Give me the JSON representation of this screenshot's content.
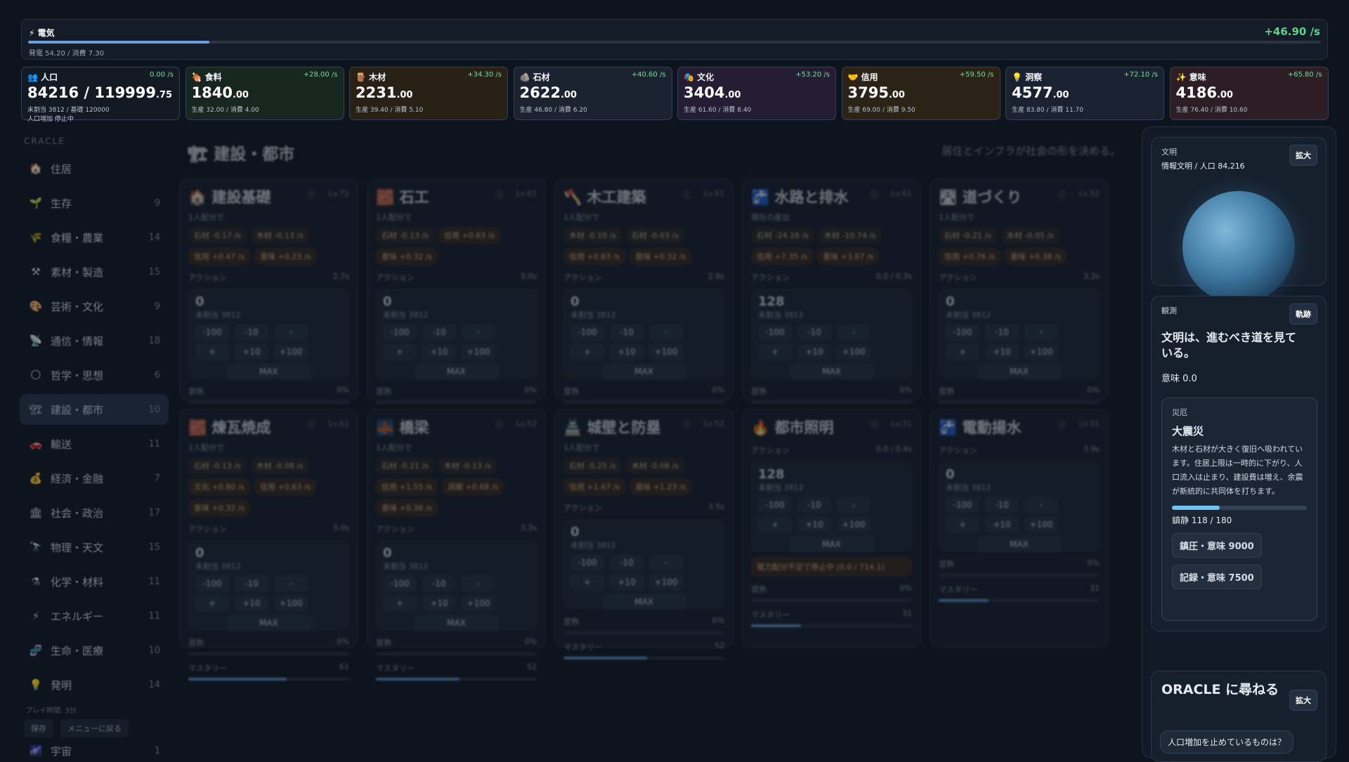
{
  "electricity": {
    "label": "⚡ 電気",
    "rate": "+46.90 /s",
    "sub": "発電 54.20 / 消費 7.30",
    "fill": 0.14
  },
  "resources": [
    {
      "icon": "👥",
      "name": "人口",
      "rate": "0.00 /s",
      "value": "84216 / 119999",
      "decimal": ".75",
      "sub": "未割当 3812 / 基礎 120000",
      "extra": "人口増加 停止中",
      "bg": "#141a24"
    },
    {
      "icon": "🍖",
      "name": "食料",
      "rate": "+28.00 /s",
      "value": "1840",
      "decimal": ".00",
      "sub": "生産 32.00 / 消費 4.00",
      "extra": "",
      "bg": "#17261e"
    },
    {
      "icon": "🪵",
      "name": "木材",
      "rate": "+34.30 /s",
      "value": "2231",
      "decimal": ".00",
      "sub": "生産 39.40 / 消費 5.10",
      "extra": "",
      "bg": "#2a2116"
    },
    {
      "icon": "🪨",
      "name": "石材",
      "rate": "+40.60 /s",
      "value": "2622",
      "decimal": ".00",
      "sub": "生産 46.80 / 消費 6.20",
      "extra": "",
      "bg": "#1c2330"
    },
    {
      "icon": "🎭",
      "name": "文化",
      "rate": "+53.20 /s",
      "value": "3404",
      "decimal": ".00",
      "sub": "生産 61.60 / 消費 8.40",
      "extra": "",
      "bg": "#241d33"
    },
    {
      "icon": "🤝",
      "name": "信用",
      "rate": "+59.50 /s",
      "value": "3795",
      "decimal": ".00",
      "sub": "生産 69.00 / 消費 9.50",
      "extra": "",
      "bg": "#2b2315"
    },
    {
      "icon": "💡",
      "name": "洞察",
      "rate": "+72.10 /s",
      "value": "4577",
      "decimal": ".00",
      "sub": "生産 83.80 / 消費 11.70",
      "extra": "",
      "bg": "#1a2231"
    },
    {
      "icon": "✨",
      "name": "意味",
      "rate": "+65.80 /s",
      "value": "4186",
      "decimal": ".00",
      "sub": "生産 76.40 / 消費 10.60",
      "extra": "",
      "bg": "#2d1d24"
    }
  ],
  "sidebar": {
    "header": "CRACLE",
    "items": [
      {
        "icon": "🏠",
        "label": "住居",
        "count": ""
      },
      {
        "icon": "🌱",
        "label": "生存",
        "count": "9"
      },
      {
        "icon": "🌾",
        "label": "食糧・農業",
        "count": "14"
      },
      {
        "icon": "⚒",
        "label": "素材・製造",
        "count": "15"
      },
      {
        "icon": "🎨",
        "label": "芸術・文化",
        "count": "9"
      },
      {
        "icon": "📡",
        "label": "通信・情報",
        "count": "18"
      },
      {
        "icon": "🌕",
        "label": "哲学・思想",
        "count": "6"
      },
      {
        "icon": "🏗",
        "label": "建設・都市",
        "count": "10"
      },
      {
        "icon": "🚗",
        "label": "輸送",
        "count": "11"
      },
      {
        "icon": "💰",
        "label": "経済・金融",
        "count": "7"
      },
      {
        "icon": "🏛",
        "label": "社会・政治",
        "count": "17"
      },
      {
        "icon": "🔭",
        "label": "物理・天文",
        "count": "15"
      },
      {
        "icon": "⚗",
        "label": "化学・材料",
        "count": "11"
      },
      {
        "icon": "⚡",
        "label": "エネルギー",
        "count": "11"
      },
      {
        "icon": "🧬",
        "label": "生命・医療",
        "count": "10"
      },
      {
        "icon": "💡",
        "label": "発明",
        "count": "14"
      }
    ],
    "playtime": "プレイ時間: 3分",
    "save": "保存",
    "menu": "メニューに戻る",
    "last": {
      "icon": "🌌",
      "label": "宇宙",
      "count": "1"
    }
  },
  "main": {
    "title": "🏗 建設・都市",
    "subtitle": "居住とインフラが社会の形を決める。",
    "labels": {
      "alloc": "1人配分で",
      "current": "現在の産出",
      "action": "アクション",
      "unassigned": "未割当 3812",
      "proficiency": "習熟",
      "mastery": "マスタリー",
      "max": "MAX"
    },
    "buttons": [
      "-100",
      "-10",
      "-",
      "+",
      "+10",
      "+100"
    ],
    "cards": [
      {
        "title": "🏠 建設基礎",
        "lv": "Lv.72",
        "time": "2.7s",
        "count": "0",
        "chips": [
          "石材 -0.17 /s",
          "木材 -0.13 /s",
          "信用 +0.47 /s",
          "意味 +0.23 /s"
        ],
        "prof": "0%",
        "mastery": "72",
        "mfill": 0.72
      },
      {
        "title": "🧱 石工",
        "lv": "Lv.61",
        "time": "3.0s",
        "count": "0",
        "chips": [
          "石材 -0.13 /s",
          "信用 +0.63 /s",
          "意味 +0.32 /s"
        ],
        "prof": "0%",
        "mastery": "61",
        "mfill": 0.61
      },
      {
        "title": "🪓 木工建築",
        "lv": "Lv.61",
        "time": "2.9s",
        "count": "0",
        "chips": [
          "木材 -0.10 /s",
          "石材 -0.03 /s",
          "信用 +0.63 /s",
          "意味 +0.32 /s"
        ],
        "prof": "0%",
        "mastery": "61",
        "mfill": 0.61
      },
      {
        "title": "🚰 水路と排水",
        "lv": "Lv.61",
        "time": "0.0 / 0.3s",
        "count": "128",
        "chips": [
          "石材 -24.16 /s",
          "木材 -10.74 /s",
          "信用 +7.35 /s",
          "意味 +3.67 /s"
        ],
        "prof": "0%",
        "mastery": "61",
        "mfill": 0.61
      },
      {
        "title": "🛣 道づくり",
        "lv": "Lv.52",
        "time": "3.3s",
        "count": "0",
        "chips": [
          "石材 -0.21 /s",
          "木材 -0.05 /s",
          "信用 +0.76 /s",
          "意味 +0.38 /s"
        ],
        "prof": "0%",
        "mastery": "52",
        "mfill": 0.52
      },
      {
        "title": "🧱 煉瓦焼成",
        "lv": "Lv.61",
        "time": "3.0s",
        "count": "0",
        "chips": [
          "石材 -0.13 /s",
          "木材 -0.08 /s",
          "文化 +0.80 /s",
          "信用 +0.63 /s",
          "意味 +0.32 /s"
        ],
        "prof": "0%",
        "mastery": "61",
        "mfill": 0.61
      },
      {
        "title": "🌉 橋梁",
        "lv": "Lv.52",
        "time": "3.3s",
        "count": "0",
        "chips": [
          "石材 -0.21 /s",
          "木材 -0.13 /s",
          "信用 +1.55 /s",
          "洞察 +0.68 /s",
          "意味 +0.38 /s"
        ],
        "prof": "0%",
        "mastery": "52",
        "mfill": 0.52
      },
      {
        "title": "🏯 城壁と防塁",
        "lv": "Lv.52",
        "time": "3.5s",
        "count": "0",
        "chips": [
          "石材 -0.25 /s",
          "木材 -0.08 /s",
          "信用 +1.67 /s",
          "意味 +1.23 /s"
        ],
        "prof": "0%",
        "mastery": "52",
        "mfill": 0.52
      },
      {
        "title": "🔥 都市照明",
        "lv": "Lv.31",
        "time": "0.0 / 0.4s",
        "count": "128",
        "chips": [],
        "warn": "電力配分不足で停止中 (0.0 / 714.1)",
        "prof": "0%",
        "mastery": "31",
        "mfill": 0.31
      },
      {
        "title": "🚰 電動揚水",
        "lv": "Lv.31",
        "time": "3.9s",
        "count": "0",
        "chips": [],
        "prof": "0%",
        "mastery": "31",
        "mfill": 0.31
      }
    ]
  },
  "right": {
    "civ": {
      "label": "文明",
      "sub": "情報文明 / 人口 84,216",
      "button": "拡大"
    },
    "observe": {
      "label": "観測",
      "button": "軌跡",
      "headline": "文明は、進むべき道を見ている。",
      "meaning": "意味 0.0"
    },
    "disaster": {
      "label": "災厄",
      "title": "大震災",
      "desc": "木材と石材が大きく復旧へ吸われています。住居上限は一時的に下がり、人口流入は止まり、建設費は増え、余震が新統的に共同体を打ちます。",
      "progress": "鎮静 118 / 180",
      "fill": 0.3556,
      "opt1": "鎮圧・意味 9000",
      "opt2": "記録・意味 7500"
    },
    "oracle": {
      "title": "ORACLE に尋ねる",
      "button": "拡大",
      "question": "人口増加を止めているものは？"
    }
  }
}
